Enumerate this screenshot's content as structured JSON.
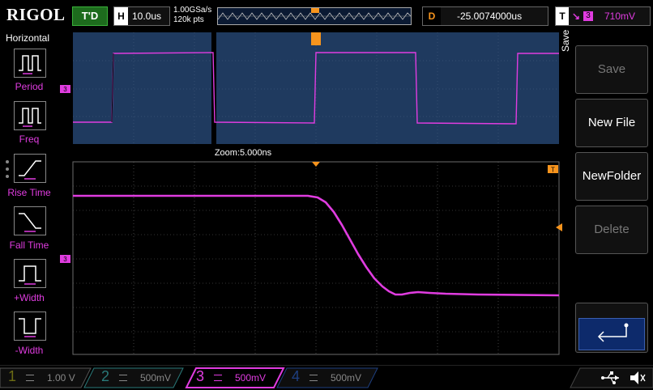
{
  "header": {
    "brand": "RIGOL",
    "run_state": "T'D",
    "timebase_tag": "H",
    "timebase": "10.0us",
    "sample_rate": "1.00GSa/s",
    "memory_depth": "120k pts",
    "delay_tag": "D",
    "delay": "-25.0074000us",
    "trigger_tag": "T",
    "trigger_source": "3",
    "trigger_level": "710mV"
  },
  "left_menu": {
    "title": "Horizontal",
    "items": [
      {
        "label": "Period",
        "icon": "period-icon"
      },
      {
        "label": "Freq",
        "icon": "freq-icon"
      },
      {
        "label": "Rise Time",
        "icon": "rise-time-icon"
      },
      {
        "label": "Fall Time",
        "icon": "fall-time-icon"
      },
      {
        "label": "+Width",
        "icon": "positive-width-icon"
      },
      {
        "label": "-Width",
        "icon": "negative-width-icon"
      }
    ]
  },
  "zoom": {
    "label": "Zoom:5.000ns",
    "channel_marker": "3",
    "trigger_marker": "T"
  },
  "right_menu": {
    "title": "Save",
    "buttons": [
      {
        "label": "Save",
        "enabled": false
      },
      {
        "label": "New File",
        "enabled": true
      },
      {
        "label": "NewFolder",
        "enabled": true
      },
      {
        "label": "Delete",
        "enabled": false
      }
    ],
    "enter_icon": "enter-return-icon"
  },
  "channels": [
    {
      "num": "1",
      "scale": "1.00 V",
      "color": "#d6d600",
      "active": false
    },
    {
      "num": "2",
      "scale": "500mV",
      "color": "#00c8c8",
      "active": false
    },
    {
      "num": "3",
      "scale": "500mV",
      "color": "#e03ce0",
      "active": true
    },
    {
      "num": "4",
      "scale": "500mV",
      "color": "#2a6de0",
      "active": false
    }
  ],
  "colors": {
    "accent_ch3": "#e03ce0",
    "trigger_orange": "#f7941d",
    "overview_bg": "#1f3a5f",
    "grid": "#6b6b6b"
  }
}
